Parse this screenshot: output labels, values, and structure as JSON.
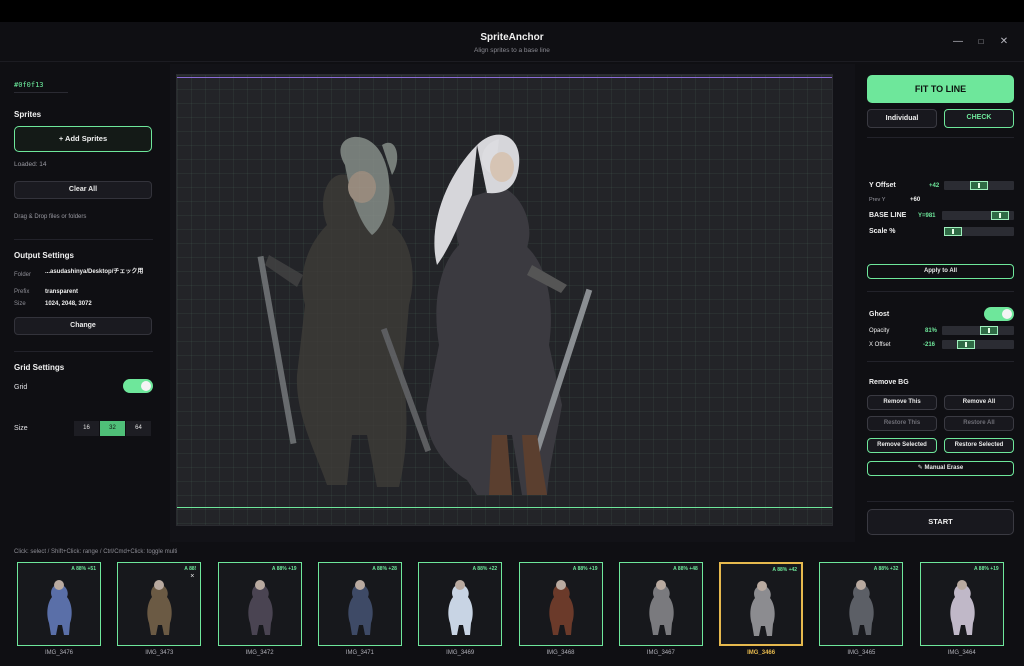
{
  "window": {
    "title": "SpriteAnchor",
    "subtitle": "Align sprites to a base line",
    "minimize_glyph": "—",
    "maximize_glyph": "□",
    "close_glyph": "✕"
  },
  "left": {
    "bg_hex": "#0f0f13",
    "sprites_title": "Sprites",
    "add_button": "+ Add Sprites",
    "loaded": "Loaded: 14",
    "clear_button": "Clear All",
    "drop_hint": "Drag & Drop files or folders",
    "output_title": "Output Settings",
    "folder_label": "Folder",
    "folder_value": "...asudashinya/Desktop/チェック用",
    "prefix_label": "Prefix",
    "prefix_value": "transparent",
    "size_label": "Size",
    "size_value": "1024, 2048, 3072",
    "change_button": "Change",
    "grid_title": "Grid Settings",
    "grid_label": "Grid",
    "grid_on": true,
    "grid_size_label": "Size",
    "grid_sizes": [
      "16",
      "32",
      "64"
    ],
    "grid_size_selected": "32"
  },
  "right": {
    "fit_button": "FIT TO LINE",
    "individual_button": "Individual",
    "check_button": "CHECK",
    "y_offset_label": "Y Offset",
    "y_offset_value": "+42",
    "prev_y_label": "Prev Y",
    "prev_y_value": "+60",
    "base_line_label": "BASE LINE",
    "base_line_value": "Y=981",
    "scale_label": "Scale %",
    "apply_all_button": "Apply to All",
    "ghost_label": "Ghost",
    "ghost_on": true,
    "opacity_label": "Opacity",
    "opacity_value": "81%",
    "x_offset_label": "X Offset",
    "x_offset_value": "-216",
    "remove_bg_title": "Remove BG",
    "remove_this": "Remove This",
    "remove_all": "Remove All",
    "restore_this": "Restore This",
    "restore_all": "Restore All",
    "remove_selected": "Remove Selected",
    "restore_selected": "Restore Selected",
    "manual_erase": "✎ Manual Erase",
    "start_button": "START"
  },
  "strip": {
    "hint": "Click: select  /  Shift+Click: range  /  Ctrl/Cmd+Click: toggle multi",
    "items": [
      {
        "tag": "A 88% +51",
        "name": "IMG_3476"
      },
      {
        "tag": "A 88!",
        "name": "IMG_3473",
        "close": "×"
      },
      {
        "tag": "A 88% +19",
        "name": "IMG_3472"
      },
      {
        "tag": "A 88% +28",
        "name": "IMG_3471"
      },
      {
        "tag": "A 88% +22",
        "name": "IMG_3469"
      },
      {
        "tag": "A 88% +19",
        "name": "IMG_3468"
      },
      {
        "tag": "A 88% +48",
        "name": "IMG_3467"
      },
      {
        "tag": "A 88% +42",
        "name": "IMG_3466",
        "selected": true
      },
      {
        "tag": "A 88% +32",
        "name": "IMG_3465"
      },
      {
        "tag": "A 88% +19",
        "name": "IMG_3464"
      }
    ]
  },
  "colors": {
    "accent": "#6ee79b",
    "selected": "#e6b94e",
    "base_line": "#6ee79b",
    "top_line": "#8a6bd6",
    "background": "#0f0f13"
  }
}
